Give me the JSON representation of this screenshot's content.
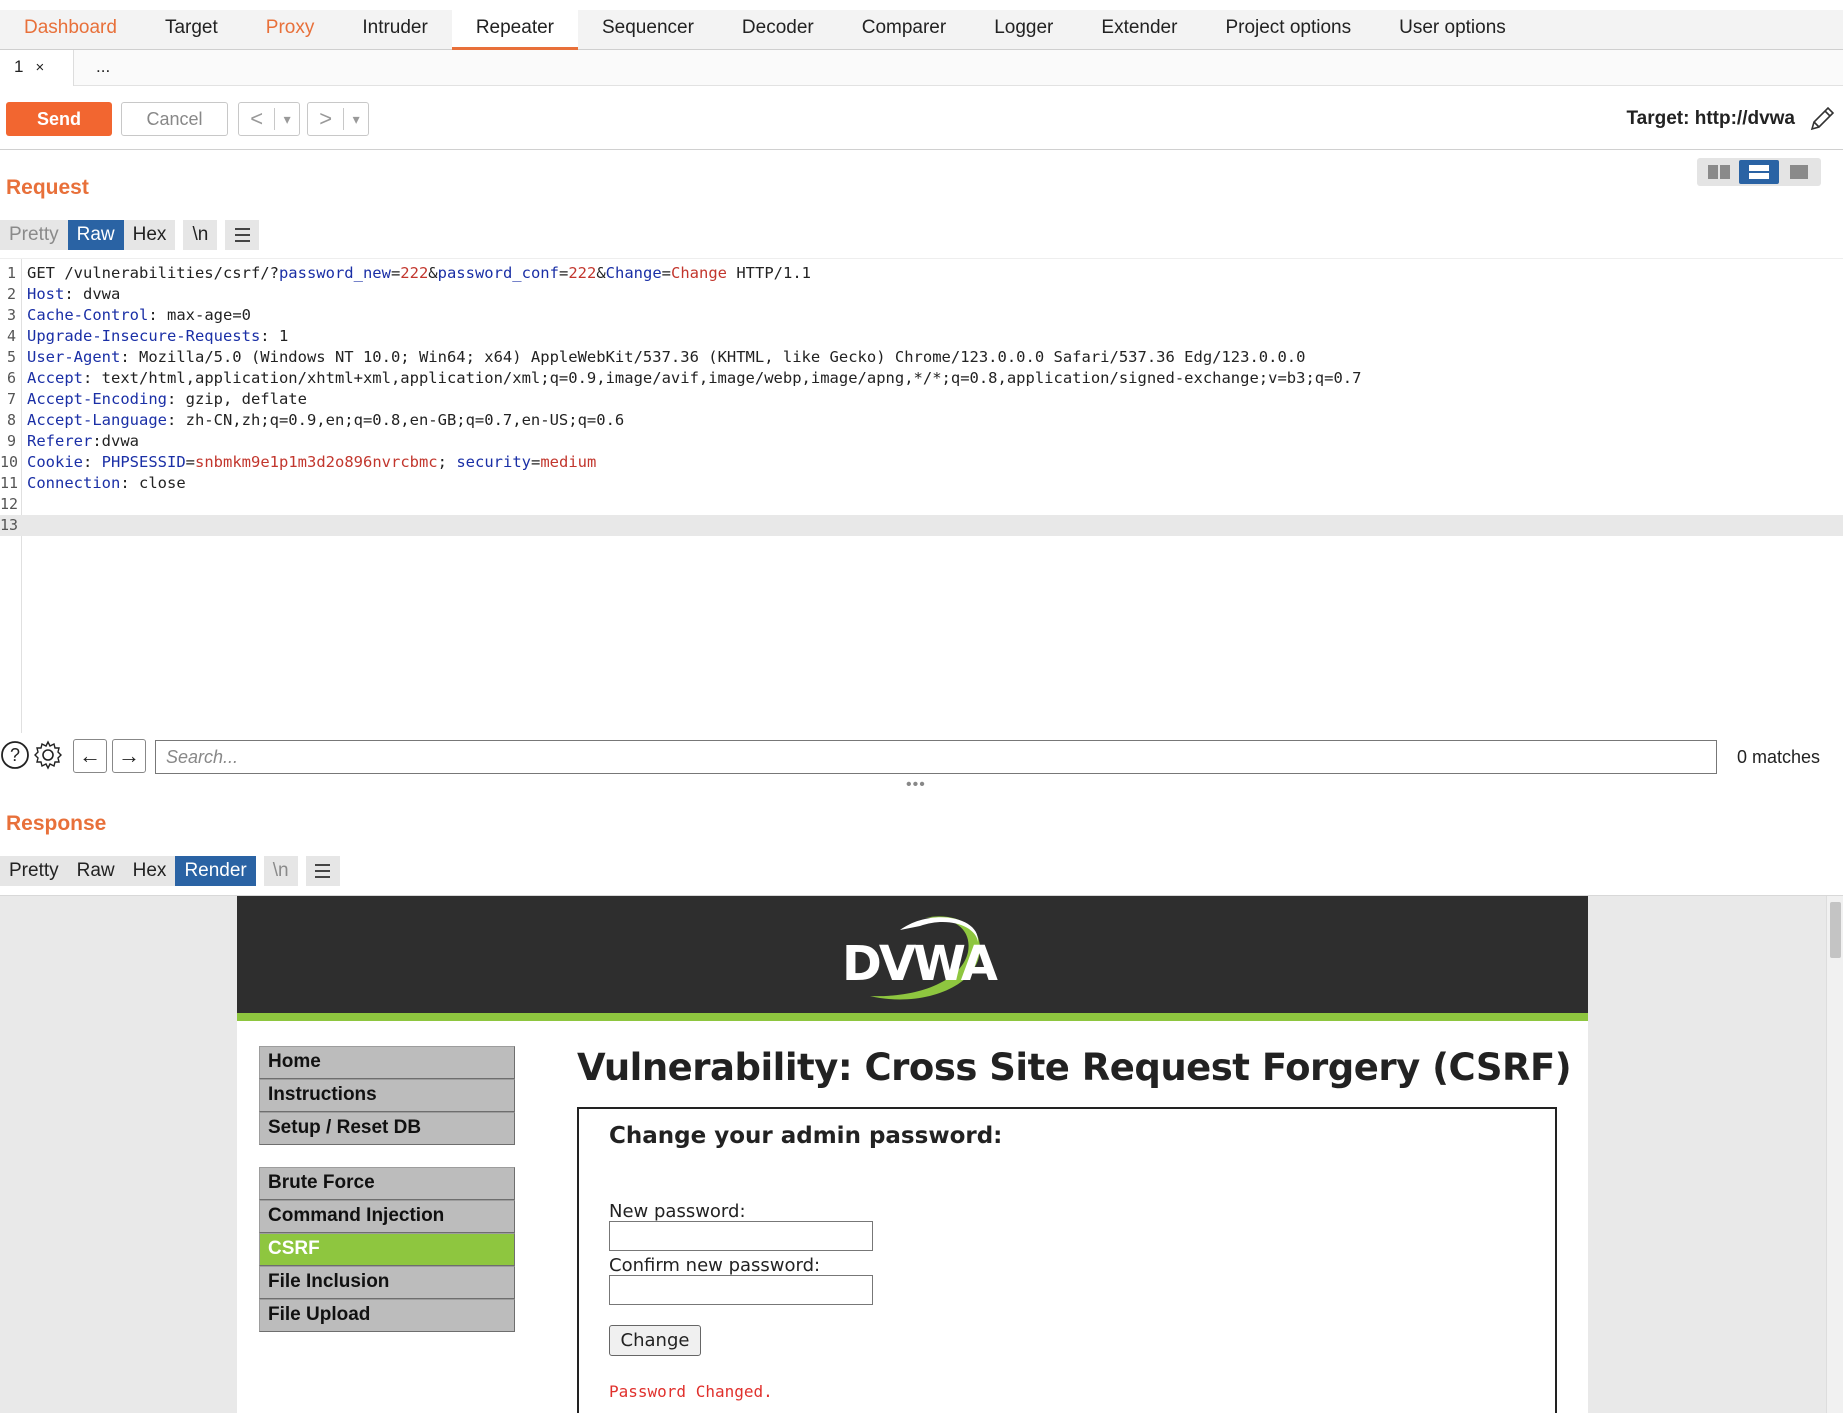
{
  "top_tabs": [
    {
      "label": "Dashboard",
      "style": "orange"
    },
    {
      "label": "Target",
      "style": "normal"
    },
    {
      "label": "Proxy",
      "style": "orange"
    },
    {
      "label": "Intruder",
      "style": "normal"
    },
    {
      "label": "Repeater",
      "style": "active"
    },
    {
      "label": "Sequencer",
      "style": "normal"
    },
    {
      "label": "Decoder",
      "style": "normal"
    },
    {
      "label": "Comparer",
      "style": "normal"
    },
    {
      "label": "Logger",
      "style": "normal"
    },
    {
      "label": "Extender",
      "style": "normal"
    },
    {
      "label": "Project options",
      "style": "normal"
    },
    {
      "label": "User options",
      "style": "normal"
    }
  ],
  "sub_tabs": {
    "active_label": "1",
    "close_glyph": "×",
    "more_label": "..."
  },
  "toolbar": {
    "send_label": "Send",
    "cancel_label": "Cancel",
    "back_glyph": "<",
    "forward_glyph": ">",
    "dropdown_glyph": "▾",
    "target_label": "Target: http://dvwa"
  },
  "request": {
    "title": "Request",
    "formats": [
      "Pretty",
      "Raw",
      "Hex",
      "\\n"
    ],
    "active_format": "Raw",
    "lines": [
      {
        "n": "1",
        "parts": [
          [
            "t",
            "GET /vulnerabilities/csrf/?"
          ],
          [
            "k",
            "password_new"
          ],
          [
            "t",
            "="
          ],
          [
            "v",
            "222"
          ],
          [
            "t",
            "&"
          ],
          [
            "k",
            "password_conf"
          ],
          [
            "t",
            "="
          ],
          [
            "v",
            "222"
          ],
          [
            "t",
            "&"
          ],
          [
            "k",
            "Change"
          ],
          [
            "t",
            "="
          ],
          [
            "v",
            "Change"
          ],
          [
            "t",
            " HTTP/1.1"
          ]
        ]
      },
      {
        "n": "2",
        "parts": [
          [
            "k",
            "Host"
          ],
          [
            "t",
            ": dvwa"
          ]
        ]
      },
      {
        "n": "3",
        "parts": [
          [
            "k",
            "Cache-Control"
          ],
          [
            "t",
            ": max-age=0"
          ]
        ]
      },
      {
        "n": "4",
        "parts": [
          [
            "k",
            "Upgrade-Insecure-Requests"
          ],
          [
            "t",
            ": 1"
          ]
        ]
      },
      {
        "n": "5",
        "parts": [
          [
            "k",
            "User-Agent"
          ],
          [
            "t",
            ": Mozilla/5.0 (Windows NT 10.0; Win64; x64) AppleWebKit/537.36 (KHTML, like Gecko) Chrome/123.0.0.0 Safari/537.36 Edg/123.0.0.0"
          ]
        ]
      },
      {
        "n": "6",
        "parts": [
          [
            "k",
            "Accept"
          ],
          [
            "t",
            ": text/html,application/xhtml+xml,application/xml;q=0.9,image/avif,image/webp,image/apng,*/*;q=0.8,application/signed-exchange;v=b3;q=0.7"
          ]
        ]
      },
      {
        "n": "7",
        "parts": [
          [
            "k",
            "Accept-Encoding"
          ],
          [
            "t",
            ": gzip, deflate"
          ]
        ]
      },
      {
        "n": "8",
        "parts": [
          [
            "k",
            "Accept-Language"
          ],
          [
            "t",
            ": zh-CN,zh;q=0.9,en;q=0.8,en-GB;q=0.7,en-US;q=0.6"
          ]
        ]
      },
      {
        "n": "9",
        "parts": [
          [
            "k",
            "Referer"
          ],
          [
            "t",
            ":dvwa"
          ]
        ]
      },
      {
        "n": "10",
        "parts": [
          [
            "k",
            "Cookie"
          ],
          [
            "t",
            ": "
          ],
          [
            "k",
            "PHPSESSID"
          ],
          [
            "t",
            "="
          ],
          [
            "v",
            "snbmkm9e1p1m3d2o896nvrcbmc"
          ],
          [
            "t",
            "; "
          ],
          [
            "k",
            "security"
          ],
          [
            "t",
            "="
          ],
          [
            "v",
            "medium"
          ]
        ]
      },
      {
        "n": "11",
        "parts": [
          [
            "k",
            "Connection"
          ],
          [
            "t",
            ": close"
          ]
        ]
      },
      {
        "n": "12",
        "parts": []
      },
      {
        "n": "13",
        "parts": []
      }
    ]
  },
  "search": {
    "placeholder": "Search...",
    "matches": "0 matches",
    "help_glyph": "?",
    "prev_glyph": "←",
    "next_glyph": "→"
  },
  "splitter_glyph": "•••",
  "response": {
    "title": "Response",
    "formats": [
      "Pretty",
      "Raw",
      "Hex",
      "Render",
      "\\n"
    ],
    "active_format": "Render"
  },
  "dvwa": {
    "logo_text": "DVWA",
    "menu": [
      "Home",
      "Instructions",
      "Setup / Reset DB",
      "Brute Force",
      "Command Injection",
      "CSRF",
      "File Inclusion",
      "File Upload"
    ],
    "selected_menu": "CSRF",
    "heading": "Vulnerability: Cross Site Request Forgery (CSRF)",
    "form_heading": "Change your admin password:",
    "new_password_label": "New password:",
    "confirm_password_label": "Confirm new password:",
    "change_button": "Change",
    "message": "Password Changed."
  },
  "colors": {
    "accent_orange": "#e8703a",
    "send_button": "#f26630",
    "active_blue": "#2a63a4",
    "dvwa_green": "#8ec63f",
    "header_key": "#1a2fa6",
    "param_value": "#c2362d",
    "message_red": "#e0302c"
  }
}
